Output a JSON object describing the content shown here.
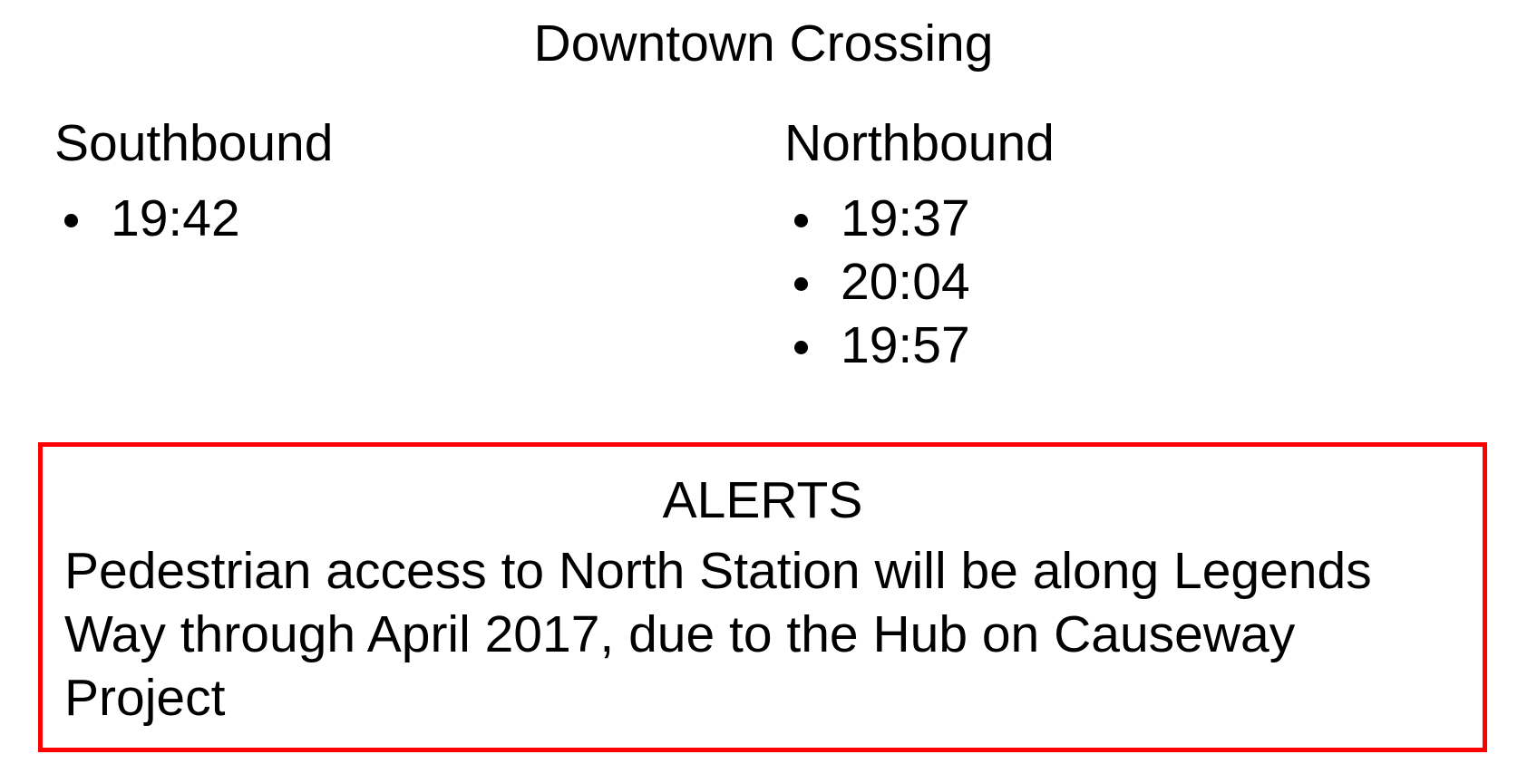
{
  "station": {
    "name": "Downtown Crossing"
  },
  "directions": {
    "southbound": {
      "label": "Southbound",
      "times": [
        "19:42"
      ]
    },
    "northbound": {
      "label": "Northbound",
      "times": [
        "19:37",
        "20:04",
        "19:57"
      ]
    }
  },
  "alerts": {
    "title": "ALERTS",
    "message": "Pedestrian access to North Station will be along Legends Way through April 2017, due to the Hub on Causeway Project",
    "border_color": "#ff0000"
  }
}
